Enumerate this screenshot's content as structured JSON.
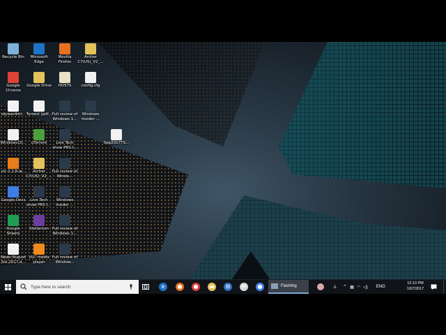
{
  "desktop": {
    "icons": [
      {
        "label": "Recycle Bin",
        "icon": "recycle-bin-icon",
        "color": "#7fb2d8"
      },
      {
        "label": "Microsoft Edge",
        "icon": "edge-icon",
        "color": "#1e73c9"
      },
      {
        "label": "Mozilla Firefox",
        "icon": "firefox-icon",
        "color": "#e8711e"
      },
      {
        "label": "Archer C7(US)_V2_...",
        "icon": "folder-zip-icon",
        "color": "#e2c35a"
      },
      {
        "label": "Google Chrome",
        "icon": "chrome-icon",
        "color": "#db4437"
      },
      {
        "label": "Google Drive",
        "icon": "folder-icon",
        "color": "#e5c35c"
      },
      {
        "label": "HOSTS",
        "icon": "file-icon",
        "color": "#e9e2c8"
      },
      {
        "label": "config.cfg",
        "icon": "file-icon",
        "color": "#f2f2f2"
      },
      {
        "label": "skywardml...",
        "icon": "document-icon",
        "color": "#f2f2f2"
      },
      {
        "label": "Torrent (pdf...",
        "icon": "pdf-icon",
        "color": "#f2f2f2"
      },
      {
        "label": "Full review of Windows 1...",
        "icon": "video-icon",
        "color": "#2b3a4a"
      },
      {
        "label": "Windows Insider ...",
        "icon": "video-icon",
        "color": "#2b3a4a"
      },
      {
        "label": "Windows10...",
        "icon": "document-icon",
        "color": "#f2f2f2"
      },
      {
        "label": "uTorrent",
        "icon": "utorrent-icon",
        "color": "#4aa03f"
      },
      {
        "label": "Live Tech show PRS t...",
        "icon": "video-icon",
        "color": "#2b3a4a"
      },
      {
        "label": "Sep2017TS...",
        "icon": "document-icon",
        "color": "#f2f2f2"
      },
      {
        "label": "vlc-2.2.6-w...",
        "icon": "vlc-installer-icon",
        "color": "#e97c1c"
      },
      {
        "label": "Archer C7(US)_V2_...",
        "icon": "folder-zip-icon",
        "color": "#e2c35a"
      },
      {
        "label": "Full review of Windo...",
        "icon": "video-icon",
        "color": "#2b3a4a"
      },
      {
        "label": "Google Docs",
        "icon": "google-docs-icon",
        "color": "#3d7de4"
      },
      {
        "label": "Live Tech show PRS t...",
        "icon": "video-icon",
        "color": "#2b3a4a"
      },
      {
        "label": "Windows Insider ...",
        "icon": "video-icon",
        "color": "#2b3a4a"
      },
      {
        "label": "Google Sheets",
        "icon": "google-sheets-icon",
        "color": "#1f9d55"
      },
      {
        "label": "Stellarium",
        "icon": "stellarium-icon",
        "color": "#6a3fa0"
      },
      {
        "label": "Full review of Windows 1...",
        "icon": "video-icon",
        "color": "#2b3a4a"
      },
      {
        "label": "News August 3rd 2017.d...",
        "icon": "document-icon",
        "color": "#f2f2f2"
      },
      {
        "label": "VLC media player",
        "icon": "vlc-icon",
        "color": "#f08a1c"
      },
      {
        "label": "Full review of Window...",
        "icon": "video-icon",
        "color": "#2b3a4a"
      }
    ]
  },
  "taskbar": {
    "search_placeholder": "Type here to search",
    "active_window_label": "Flashing",
    "pinned": [
      {
        "name": "edge-taskbar-icon",
        "color": "#1e73c9",
        "glyph": "e"
      },
      {
        "name": "firefox-taskbar-icon",
        "color": "#e8711e",
        "glyph": "●"
      },
      {
        "name": "chrome-taskbar-icon",
        "color": "#db4437",
        "glyph": "●"
      },
      {
        "name": "file-explorer-taskbar-icon",
        "color": "#e5c35c",
        "glyph": "▬"
      },
      {
        "name": "store-taskbar-icon",
        "color": "#2f6fc4",
        "glyph": "⊞"
      },
      {
        "name": "mail-taskbar-icon",
        "color": "#d8d8d8",
        "glyph": "✉"
      },
      {
        "name": "chrome-taskbar-icon-2",
        "color": "#4285f4",
        "glyph": "●"
      }
    ],
    "tray": {
      "language": "ENG",
      "time": "12:13 PM",
      "date": "10/7/2017"
    }
  }
}
